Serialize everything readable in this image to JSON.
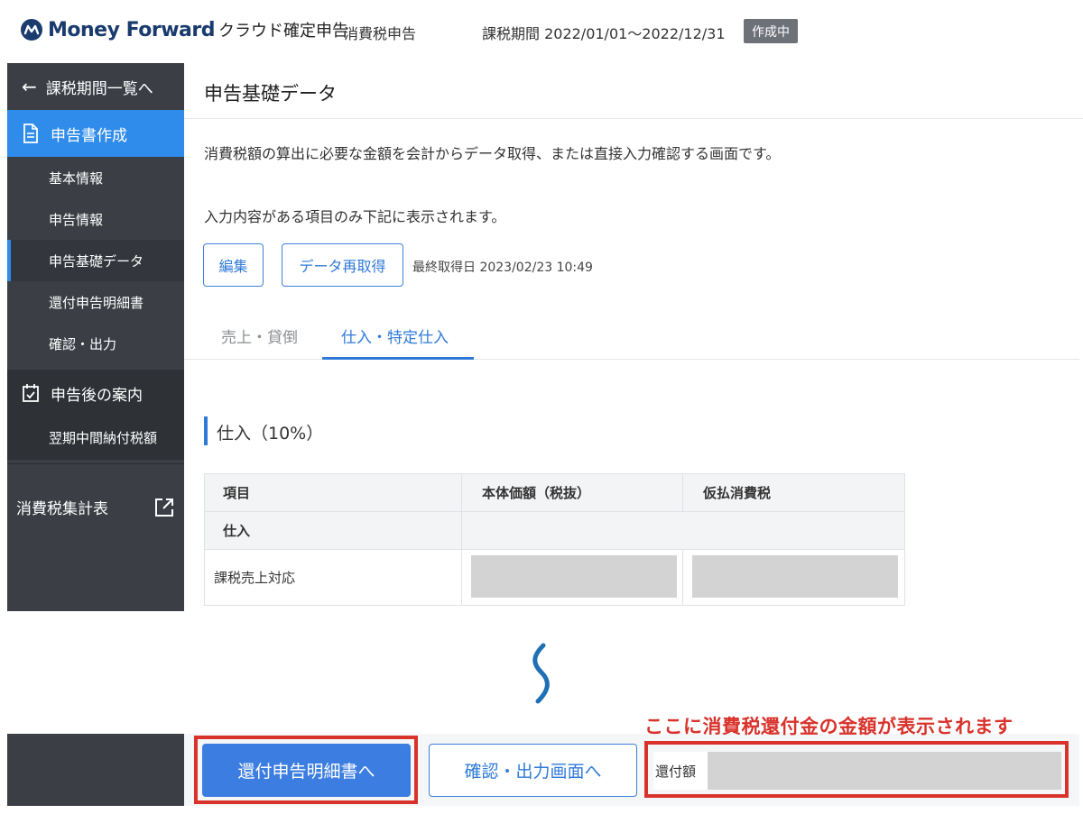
{
  "header": {
    "brand": "Money Forward",
    "product": "クラウド確定申告",
    "section": "消費税申告",
    "period": "課税期間 2022/01/01〜2022/12/31",
    "status_badge": "作成中"
  },
  "sidebar": {
    "back_label": "課税期間一覧へ",
    "main_label": "申告書作成",
    "sub_items": [
      {
        "label": "基本情報"
      },
      {
        "label": "申告情報"
      },
      {
        "label": "申告基礎データ",
        "active": true
      },
      {
        "label": "還付申告明細書"
      },
      {
        "label": "確認・出力"
      }
    ],
    "after_label": "申告後の案内",
    "after_sub": "翌期中間納付税額",
    "external_link": "消費税集計表"
  },
  "main": {
    "title": "申告基礎データ",
    "description_1": "消費税額の算出に必要な金額を会計からデータ取得、または直接入力確認する画面です。",
    "description_2": "入力内容がある項目のみ下記に表示されます。",
    "edit_button": "編集",
    "refetch_button": "データ再取得",
    "last_fetch": "最終取得日 2023/02/23 10:49",
    "tabs": [
      {
        "label": "売上・貸倒"
      },
      {
        "label": "仕入・特定仕入",
        "active": true
      }
    ],
    "section_title": "仕入（10%）",
    "table": {
      "headers": [
        "項目",
        "本体価額（税抜）",
        "仮払消費税"
      ],
      "group": "仕入",
      "rows": [
        {
          "label": "課税売上対応"
        }
      ]
    }
  },
  "bottom": {
    "annotation": "ここに消費税還付金の金額が表示されます",
    "primary_button": "還付申告明細書へ",
    "secondary_button": "確認・出力画面へ",
    "refund_label": "還付額"
  },
  "colors": {
    "accent": "#2f8cea",
    "sidebar_bg": "#3b3f45",
    "annotation_red": "#d9322b",
    "brand_navy": "#1a3b6e"
  }
}
